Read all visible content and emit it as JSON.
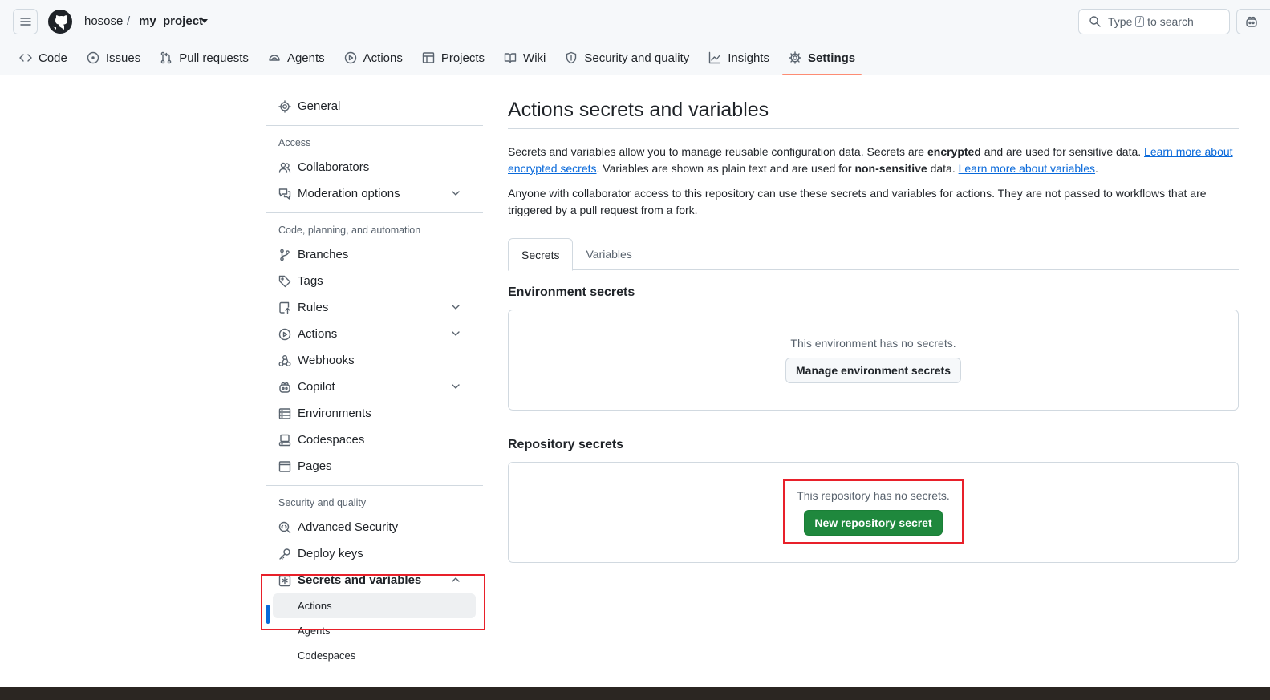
{
  "header": {
    "owner": "hosose",
    "separator": "/",
    "repo": "my_project",
    "search_prefix": "Type",
    "search_key": "/",
    "search_suffix": "to search"
  },
  "repo_tabs": [
    {
      "label": "Code",
      "icon": "code-icon"
    },
    {
      "label": "Issues",
      "icon": "issue-icon"
    },
    {
      "label": "Pull requests",
      "icon": "pull-request-icon"
    },
    {
      "label": "Agents",
      "icon": "agents-icon"
    },
    {
      "label": "Actions",
      "icon": "play-icon"
    },
    {
      "label": "Projects",
      "icon": "table-icon"
    },
    {
      "label": "Wiki",
      "icon": "book-icon"
    },
    {
      "label": "Security and quality",
      "icon": "shield-icon"
    },
    {
      "label": "Insights",
      "icon": "graph-icon"
    },
    {
      "label": "Settings",
      "icon": "gear-icon",
      "active": true
    }
  ],
  "sidebar": {
    "general": "General",
    "access_heading": "Access",
    "collaborators": "Collaborators",
    "moderation": "Moderation options",
    "code_heading": "Code, planning, and automation",
    "branches": "Branches",
    "tags": "Tags",
    "rules": "Rules",
    "actions": "Actions",
    "webhooks": "Webhooks",
    "copilot": "Copilot",
    "environments": "Environments",
    "codespaces": "Codespaces",
    "pages": "Pages",
    "security_heading": "Security and quality",
    "advanced_security": "Advanced Security",
    "deploy_keys": "Deploy keys",
    "secrets_vars": "Secrets and variables",
    "sub_actions": "Actions",
    "sub_agents": "Agents",
    "sub_codespaces": "Codespaces"
  },
  "main": {
    "title": "Actions secrets and variables",
    "p1_a": "Secrets and variables allow you to manage reusable configuration data. Secrets are ",
    "p1_b": "encrypted",
    "p1_c": " and are used for sensitive data. ",
    "p1_link1": "Learn more about encrypted secrets",
    "p1_d": ". Variables are shown as plain text and are used for ",
    "p1_e": "non-sensitive",
    "p1_f": " data. ",
    "p1_link2": "Learn more about variables",
    "p1_g": ".",
    "p2": "Anyone with collaborator access to this repository can use these secrets and variables for actions. They are not passed to workflows that are triggered by a pull request from a fork.",
    "tab_secrets": "Secrets",
    "tab_variables": "Variables",
    "env_title": "Environment secrets",
    "env_msg": "This environment has no secrets.",
    "env_button": "Manage environment secrets",
    "repo_title": "Repository secrets",
    "repo_msg": "This repository has no secrets.",
    "repo_button": "New repository secret"
  },
  "colors": {
    "accent": "#0969da",
    "primary_button": "#1f883d",
    "highlight": "#e8202a",
    "active_tab_underline": "#fd8c73"
  }
}
